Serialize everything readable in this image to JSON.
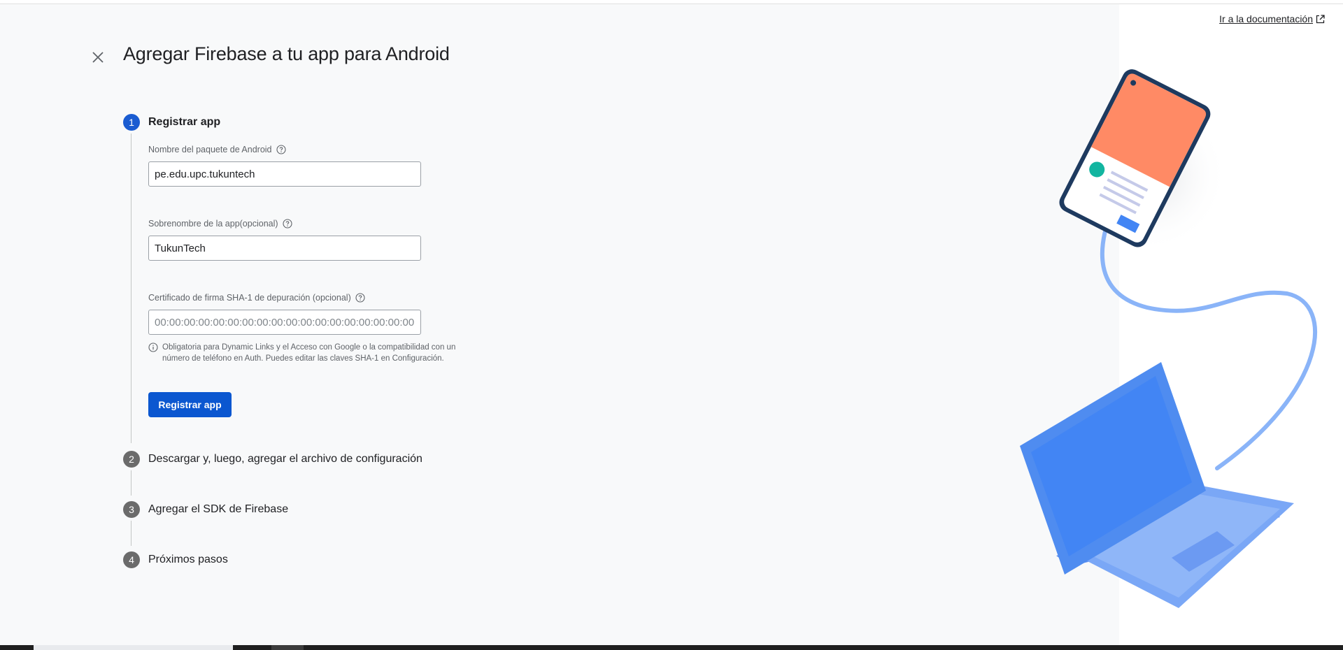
{
  "header": {
    "title": "Agregar Firebase a tu app para Android",
    "close_icon": "close-icon",
    "doc_link_label": "Ir a la documentación",
    "doc_link_icon": "open-in-new-icon"
  },
  "steps": [
    {
      "number": "1",
      "label": "Registrar app",
      "state": "active"
    },
    {
      "number": "2",
      "label": "Descargar y, luego, agregar el archivo de configuración",
      "state": "pending"
    },
    {
      "number": "3",
      "label": "Agregar el SDK de Firebase",
      "state": "pending"
    },
    {
      "number": "4",
      "label": "Próximos pasos",
      "state": "pending"
    }
  ],
  "form": {
    "package_name": {
      "label": "Nombre del paquete de Android",
      "value": "pe.edu.upc.tukuntech"
    },
    "nickname": {
      "label": "Sobrenombre de la app(opcional)",
      "value": "TukunTech"
    },
    "sha1": {
      "label": "Certificado de firma SHA-1 de depuración (opcional)",
      "placeholder": "00:00:00:00:00:00:00:00:00:00:00:00:00:00:00:00:00:00:00:00",
      "value": ""
    },
    "hint": "Obligatoria para Dynamic Links y el Acceso con Google o la compatibilidad con un número de teléfono en Auth. Puedes editar las claves SHA-1 en Configuración.",
    "submit_label": "Registrar app"
  },
  "colors": {
    "accent": "#0b57d0",
    "active_step": "#1a5cd1",
    "inactive_step": "#6b6b6b",
    "panel_bg": "#f8f9fa",
    "phone_screen": "#ff8a65",
    "laptop": "#4285f4",
    "cable": "#8ab4f8"
  }
}
